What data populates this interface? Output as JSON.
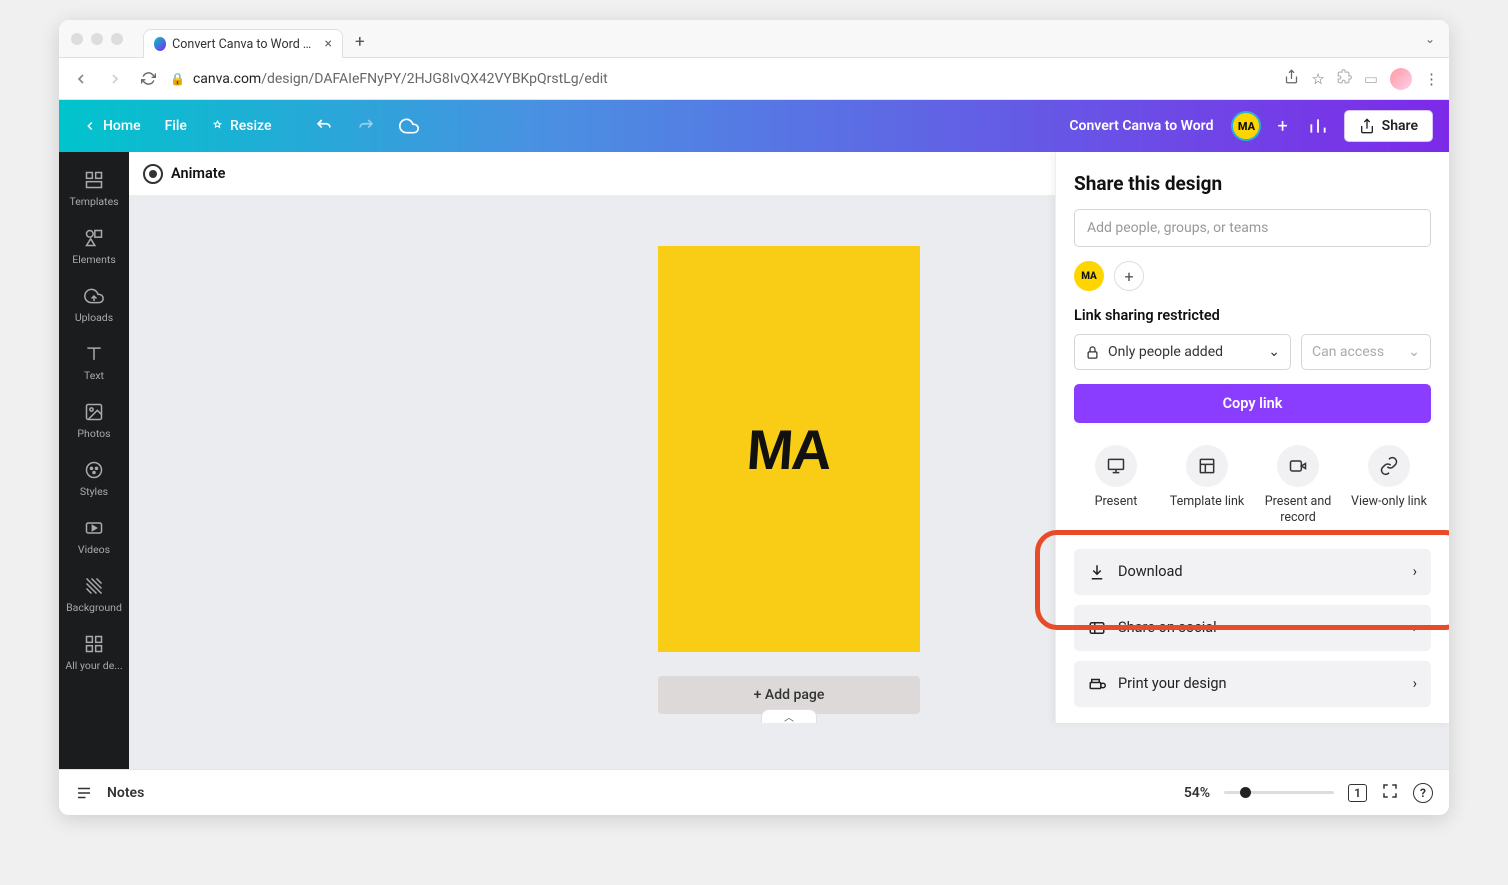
{
  "browser": {
    "tab_title": "Convert Canva to Word - Flyer",
    "url_host": "canva.com",
    "url_path": "/design/DAFAIeFNyPY/2HJG8IvQX42VYBKpQrstLg/edit"
  },
  "header": {
    "home": "Home",
    "file": "File",
    "resize": "Resize",
    "doc_title": "Convert Canva to Word",
    "user_initials": "MA",
    "share": "Share"
  },
  "object_panel": {
    "items": [
      "Templates",
      "Elements",
      "Uploads",
      "Text",
      "Photos",
      "Styles",
      "Videos",
      "Background",
      "All your de..."
    ]
  },
  "animate_bar": {
    "label": "Animate"
  },
  "canvas": {
    "design_text": "MA",
    "add_page": "+ Add page"
  },
  "footer": {
    "notes": "Notes",
    "zoom": "54%",
    "page_indicator": "1"
  },
  "share_panel": {
    "title": "Share this design",
    "add_people_placeholder": "Add people, groups, or teams",
    "user_initials": "MA",
    "link_sharing_label": "Link sharing restricted",
    "access_select": "Only people added",
    "permission_select": "Can access",
    "copy_link": "Copy link",
    "actions": {
      "present": "Present",
      "template_link": "Template link",
      "present_record": "Present and record",
      "view_only": "View-only link"
    },
    "list": {
      "download": "Download",
      "share_social": "Share on social",
      "print_design": "Print your design"
    }
  }
}
